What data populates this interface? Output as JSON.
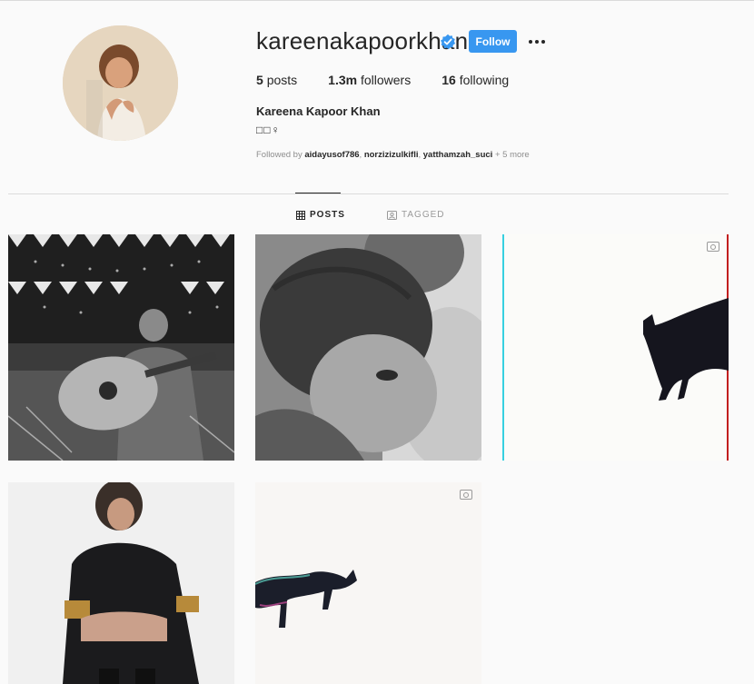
{
  "profile": {
    "username": "kareenakapoorkhan",
    "follow_label": "Follow",
    "full_name": "Kareena Kapoor Khan",
    "bio": "□□♀",
    "stats": {
      "posts_count": "5",
      "posts_label": "posts",
      "followers_count": "1.3m",
      "followers_label": "followers",
      "following_count": "16",
      "following_label": "following"
    },
    "followed_by": {
      "prefix": "Followed by",
      "users": [
        "aidayusof786",
        "norzizizulkifli",
        "yatthamzah_suci"
      ],
      "more": "+ 5 more"
    }
  },
  "tabs": [
    {
      "label": "POSTS",
      "icon": "grid-icon",
      "active": true
    },
    {
      "label": "TAGGED",
      "icon": "tagged-icon",
      "active": false
    }
  ],
  "colors": {
    "accent": "#3897f0",
    "verified": "#3897f0",
    "background": "#fafafa",
    "text": "#262626",
    "muted": "#8e8e8e"
  },
  "posts": [
    {
      "subject": "black-and-white photo of man playing guitar",
      "type": "photo"
    },
    {
      "subject": "black-and-white photo of child resting on shoulder",
      "type": "photo"
    },
    {
      "subject": "black cat walking on white background",
      "type": "igtv-video"
    },
    {
      "subject": "woman in black tracksuit sitting",
      "type": "photo"
    },
    {
      "subject": "glitch image of cat walking on white background",
      "type": "igtv-video"
    }
  ]
}
